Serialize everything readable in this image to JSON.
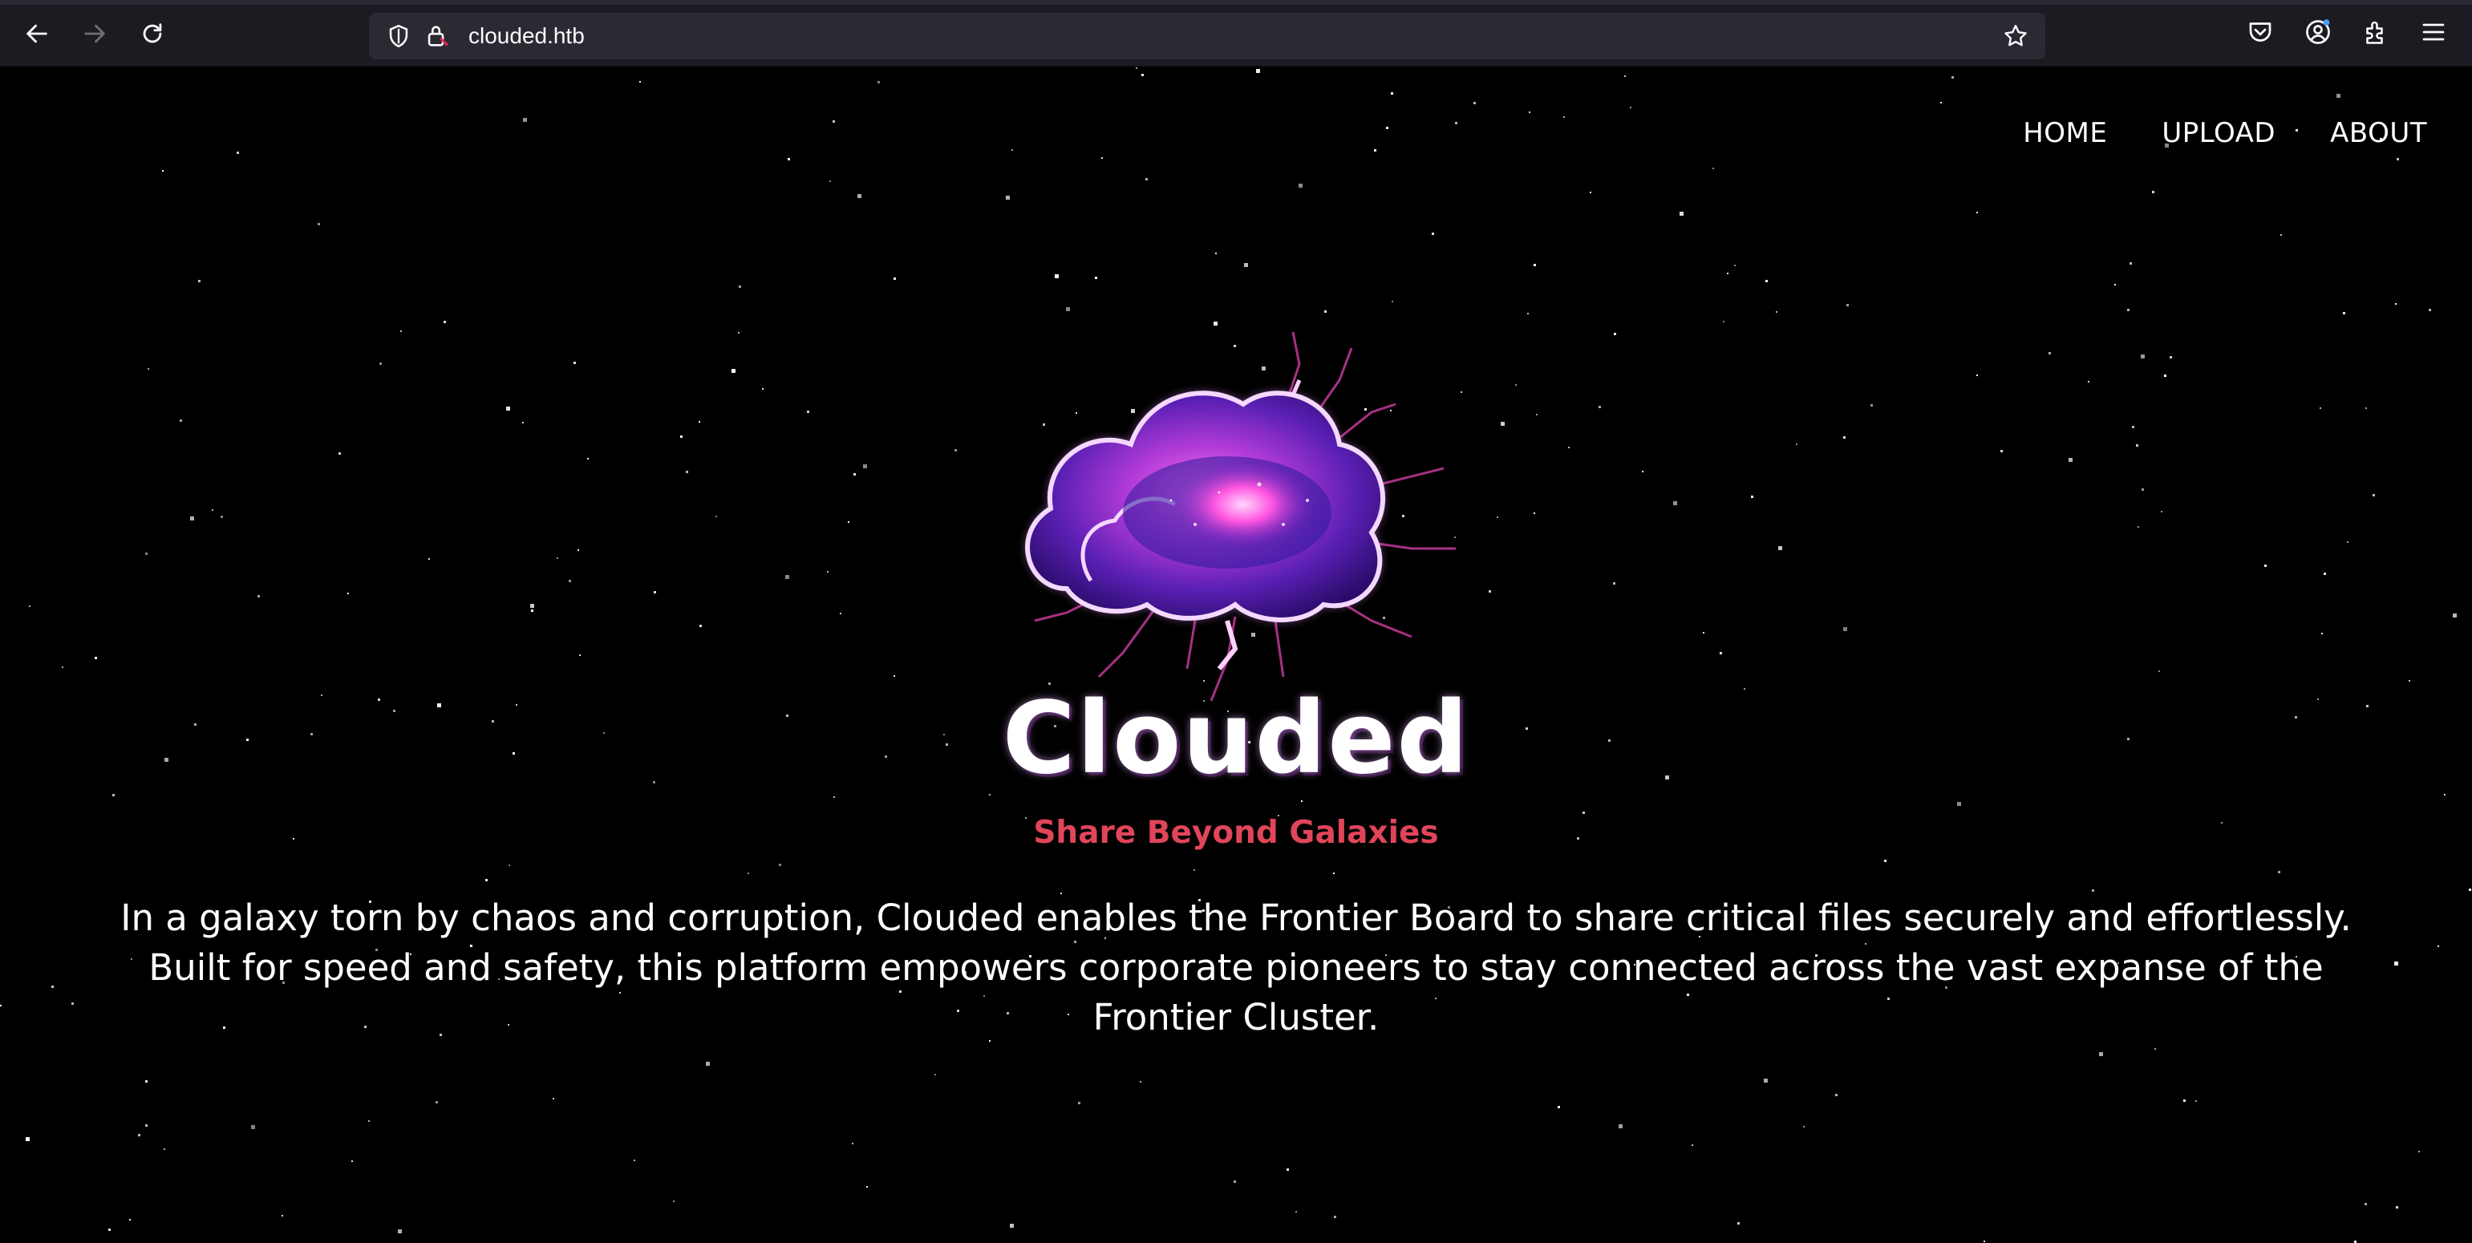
{
  "browser": {
    "url": "clouded.htb",
    "icons": [
      "back-arrow-icon",
      "forward-arrow-icon",
      "reload-icon",
      "shield-icon",
      "insecure-lock-icon",
      "bookmark-star-icon",
      "pocket-icon",
      "account-icon",
      "extensions-icon",
      "menu-icon"
    ]
  },
  "nav": {
    "items": [
      "HOME",
      "UPLOAD",
      "ABOUT"
    ]
  },
  "hero": {
    "title": "Clouded",
    "tagline": "Share Beyond Galaxies",
    "description": "In a galaxy torn by chaos and corruption, Clouded enables the Frontier Board to share critical files securely and effortlessly. Built for speed and safety, this platform empowers corporate pioneers to stay connected across the vast expanse of the Frontier Cluster."
  },
  "colors": {
    "background": "#000000",
    "accent": "#e0455a",
    "cloud_purple": "#b43cd8",
    "cloud_blue": "#3b2bd6"
  }
}
